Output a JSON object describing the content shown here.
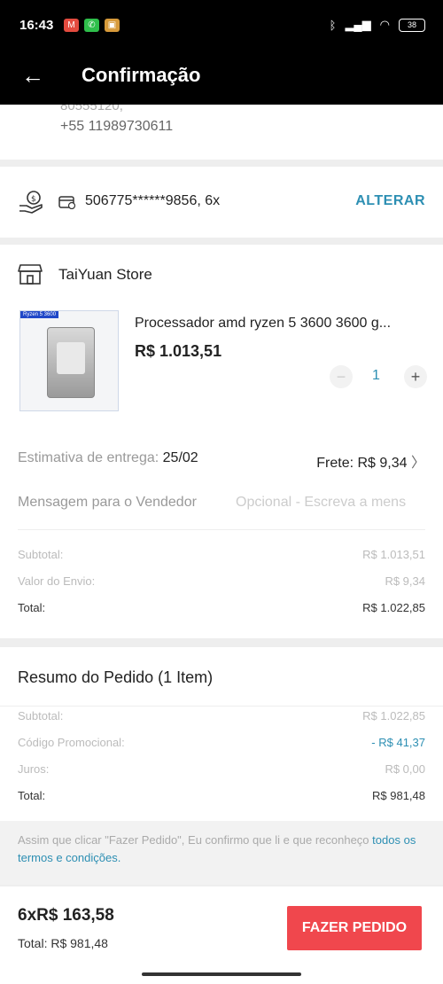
{
  "status_bar": {
    "time": "16:43",
    "battery": "38"
  },
  "app_bar": {
    "title": "Confirmação"
  },
  "address": {
    "partial_text": "80555120,",
    "phone": "+55 11989730611"
  },
  "payment": {
    "card": "506775******9856, 6x",
    "change_label": "ALTERAR"
  },
  "store": {
    "name": "TaiYuan Store",
    "product": {
      "image_tag": "Ryzen 5 3600",
      "name": "Processador amd ryzen 5 3600 3600 g...",
      "price": "R$ 1.013,51",
      "quantity": "1"
    },
    "delivery_label": "Estimativa de entrega:",
    "delivery_date": "25/02",
    "shipping": "Frete: R$ 9,34",
    "message_label": "Mensagem para o Vendedor",
    "message_placeholder": "Opcional - Escreva a mens",
    "summary": [
      {
        "label": "Subtotal:",
        "value": "R$ 1.013,51"
      },
      {
        "label": "Valor do Envio:",
        "value": "R$ 9,34"
      },
      {
        "label": "Total:",
        "value": "R$ 1.022,85"
      }
    ]
  },
  "order_summary": {
    "title": "Resumo do Pedido (1 Item)",
    "rows": [
      {
        "label": "Subtotal:",
        "value": "R$ 1.022,85"
      },
      {
        "label": "Código Promocional:",
        "value": "- R$ 41,37"
      },
      {
        "label": "Juros:",
        "value": "R$ 0,00"
      },
      {
        "label": "Total:",
        "value": "R$ 981,48"
      }
    ],
    "terms_text": "Assim que clicar \"Fazer Pedido\", Eu confirmo que li e que reconheço",
    "terms_link": "todos os termos e condições."
  },
  "footer": {
    "installment": "6xR$ 163,58",
    "total": "Total: R$ 981,48",
    "cta_label": "FAZER PEDIDO"
  },
  "colors": {
    "accent": "#2d8fb3",
    "cta": "#f0474d"
  }
}
